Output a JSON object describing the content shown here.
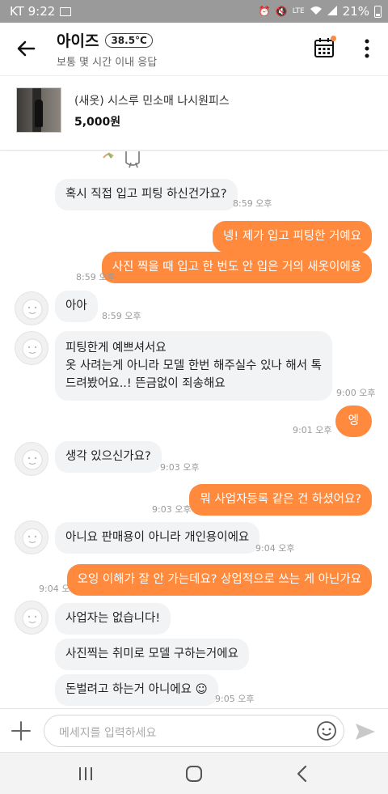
{
  "status_bar": {
    "carrier_time": "KT 9:22",
    "battery": "21%",
    "icons": [
      "image-icon",
      "alarm-icon",
      "mute-icon",
      "lte-icon",
      "wifi-icon",
      "signal-icon",
      "battery-icon"
    ]
  },
  "header": {
    "name": "아이즈",
    "temperature": "38.5°C",
    "subtitle": "보통 몇 시간 이내 응답",
    "icons": [
      "back-arrow-icon",
      "calendar-icon",
      "more-vertical-icon"
    ]
  },
  "product": {
    "title": "(새옷) 시스루 민소매 나시원피스",
    "price": "5,000원"
  },
  "messages": [
    {
      "side": "in",
      "text": "혹시 직접 입고 피팅 하신건가요?",
      "time": "8:59 오후",
      "avatar": false
    },
    {
      "side": "out",
      "text": "넹! 제가 입고 피팅한 거예요",
      "time": "",
      "avatar": false
    },
    {
      "side": "out",
      "text": "사진 찍을 때 입고 한 번도 안 입은 거의 새옷이에용",
      "time": "8:59 오후",
      "avatar": false
    },
    {
      "side": "in",
      "text": "아아",
      "time": "8:59 오후",
      "avatar": true
    },
    {
      "side": "in",
      "lines": [
        "피팅한게 예쁘셔서요",
        "옷 사려는게 아니라 모델 한번 해주실수 있나 해서 톡",
        "드려봤어요..!  뜬금없이 죄송해요"
      ],
      "time": "9:00 오후",
      "avatar": true
    },
    {
      "side": "out",
      "text": "엥",
      "time": "9:01 오후",
      "avatar": false
    },
    {
      "side": "in",
      "text": "생각 있으신가요?",
      "time": "9:03 오후",
      "avatar": true
    },
    {
      "side": "out",
      "text": "뭐 사업자등록 같은 건 하셨어요?",
      "time": "9:03 오후",
      "avatar": false
    },
    {
      "side": "in",
      "text": "아니요 판매용이 아니라 개인용이에요",
      "time": "9:04 오후",
      "avatar": true
    },
    {
      "side": "out",
      "text": "오잉 이해가 잘 안 가는데요? 상업적으로 쓰는 게 아닌가요",
      "time": "9:04 오후",
      "avatar": false
    },
    {
      "side": "in",
      "text": "사업자는 없습니다!",
      "time": "",
      "avatar": true
    },
    {
      "side": "in",
      "text": "사진찍는 취미로 모델 구하는거에요",
      "time": "",
      "avatar": false
    },
    {
      "side": "in",
      "text": "돈벌려고 하는거 아니에요 ☺",
      "time": "9:05 오후",
      "avatar": false
    }
  ],
  "input": {
    "placeholder": "메세지를 입력하세요",
    "icons": [
      "plus-icon",
      "emoji-icon",
      "send-icon"
    ]
  },
  "nav": {
    "icons": [
      "recent-apps-icon",
      "home-icon",
      "nav-back-icon"
    ]
  },
  "colors": {
    "accent": "#ff8a3d",
    "incoming_bubble": "#f1f3f5",
    "status_bar": "#9a9a9a"
  }
}
